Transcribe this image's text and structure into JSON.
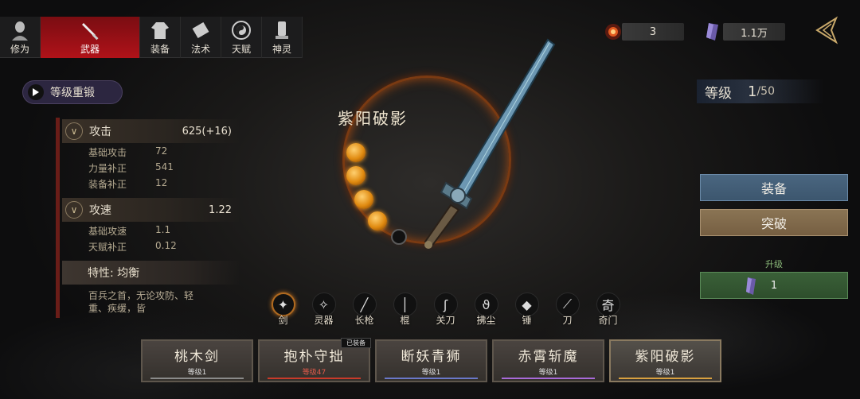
{
  "tabs": [
    {
      "label": "修为",
      "icon": "bald-monk-icon"
    },
    {
      "label": "武器",
      "icon": "sword-icon",
      "active": true
    },
    {
      "label": "装备",
      "icon": "robe-icon"
    },
    {
      "label": "法术",
      "icon": "scroll-icon"
    },
    {
      "label": "天赋",
      "icon": "yin-yang-icon"
    },
    {
      "label": "神灵",
      "icon": "tablet-icon"
    }
  ],
  "resources": {
    "fire_count": "3",
    "crystal_count": "1.1万"
  },
  "reforge": {
    "label": "等级重锻"
  },
  "stats": {
    "attack": {
      "label": "攻击",
      "value": "625(+16)",
      "rows": [
        {
          "n": "基础攻击",
          "v": "72"
        },
        {
          "n": "力量补正",
          "v": "541"
        },
        {
          "n": "装备补正",
          "v": "12"
        }
      ]
    },
    "speed": {
      "label": "攻速",
      "value": "1.22",
      "rows": [
        {
          "n": "基础攻速",
          "v": "1.1"
        },
        {
          "n": "天赋补正",
          "v": "0.12"
        }
      ]
    },
    "trait": "特性: 均衡",
    "description": "百兵之首，无论攻防、轻重、疾缓，皆"
  },
  "weapon": {
    "name": "紫阳破影",
    "orbs_filled": 4,
    "orbs_total": 5
  },
  "level": {
    "label": "等级",
    "current": "1",
    "max": "/50"
  },
  "actions": {
    "equip": "装备",
    "breakthrough": "突破",
    "upgrade_label": "升级",
    "upgrade_cost": "1"
  },
  "categories": [
    {
      "label": "剑",
      "glyph": "✦",
      "active": true
    },
    {
      "label": "灵器",
      "glyph": "✧"
    },
    {
      "label": "长枪",
      "glyph": "╱"
    },
    {
      "label": "棍",
      "glyph": "│"
    },
    {
      "label": "关刀",
      "glyph": "ʃ"
    },
    {
      "label": "拂尘",
      "glyph": "ϑ"
    },
    {
      "label": "锤",
      "glyph": "◆"
    },
    {
      "label": "刀",
      "glyph": "⟋"
    },
    {
      "label": "奇门",
      "glyph": "奇"
    }
  ],
  "cards": [
    {
      "name": "桃木剑",
      "level": "等级1",
      "stripe": "#8a8a8a"
    },
    {
      "name": "抱朴守拙",
      "level": "等级47",
      "stripe": "#c83a2a",
      "equipped_badge": "已装备"
    },
    {
      "name": "断妖青狮",
      "level": "等级1",
      "stripe": "#6a78c8"
    },
    {
      "name": "赤霄斩魔",
      "level": "等级1",
      "stripe": "#a86ad8"
    },
    {
      "name": "紫阳破影",
      "level": "等级1",
      "stripe": "#d8a040",
      "selected": true
    }
  ],
  "colors": {
    "active_tab": "#b01219",
    "equip_btn": "#4a6680",
    "break_btn": "#8a7454",
    "upgrade_btn": "#3a6038"
  }
}
